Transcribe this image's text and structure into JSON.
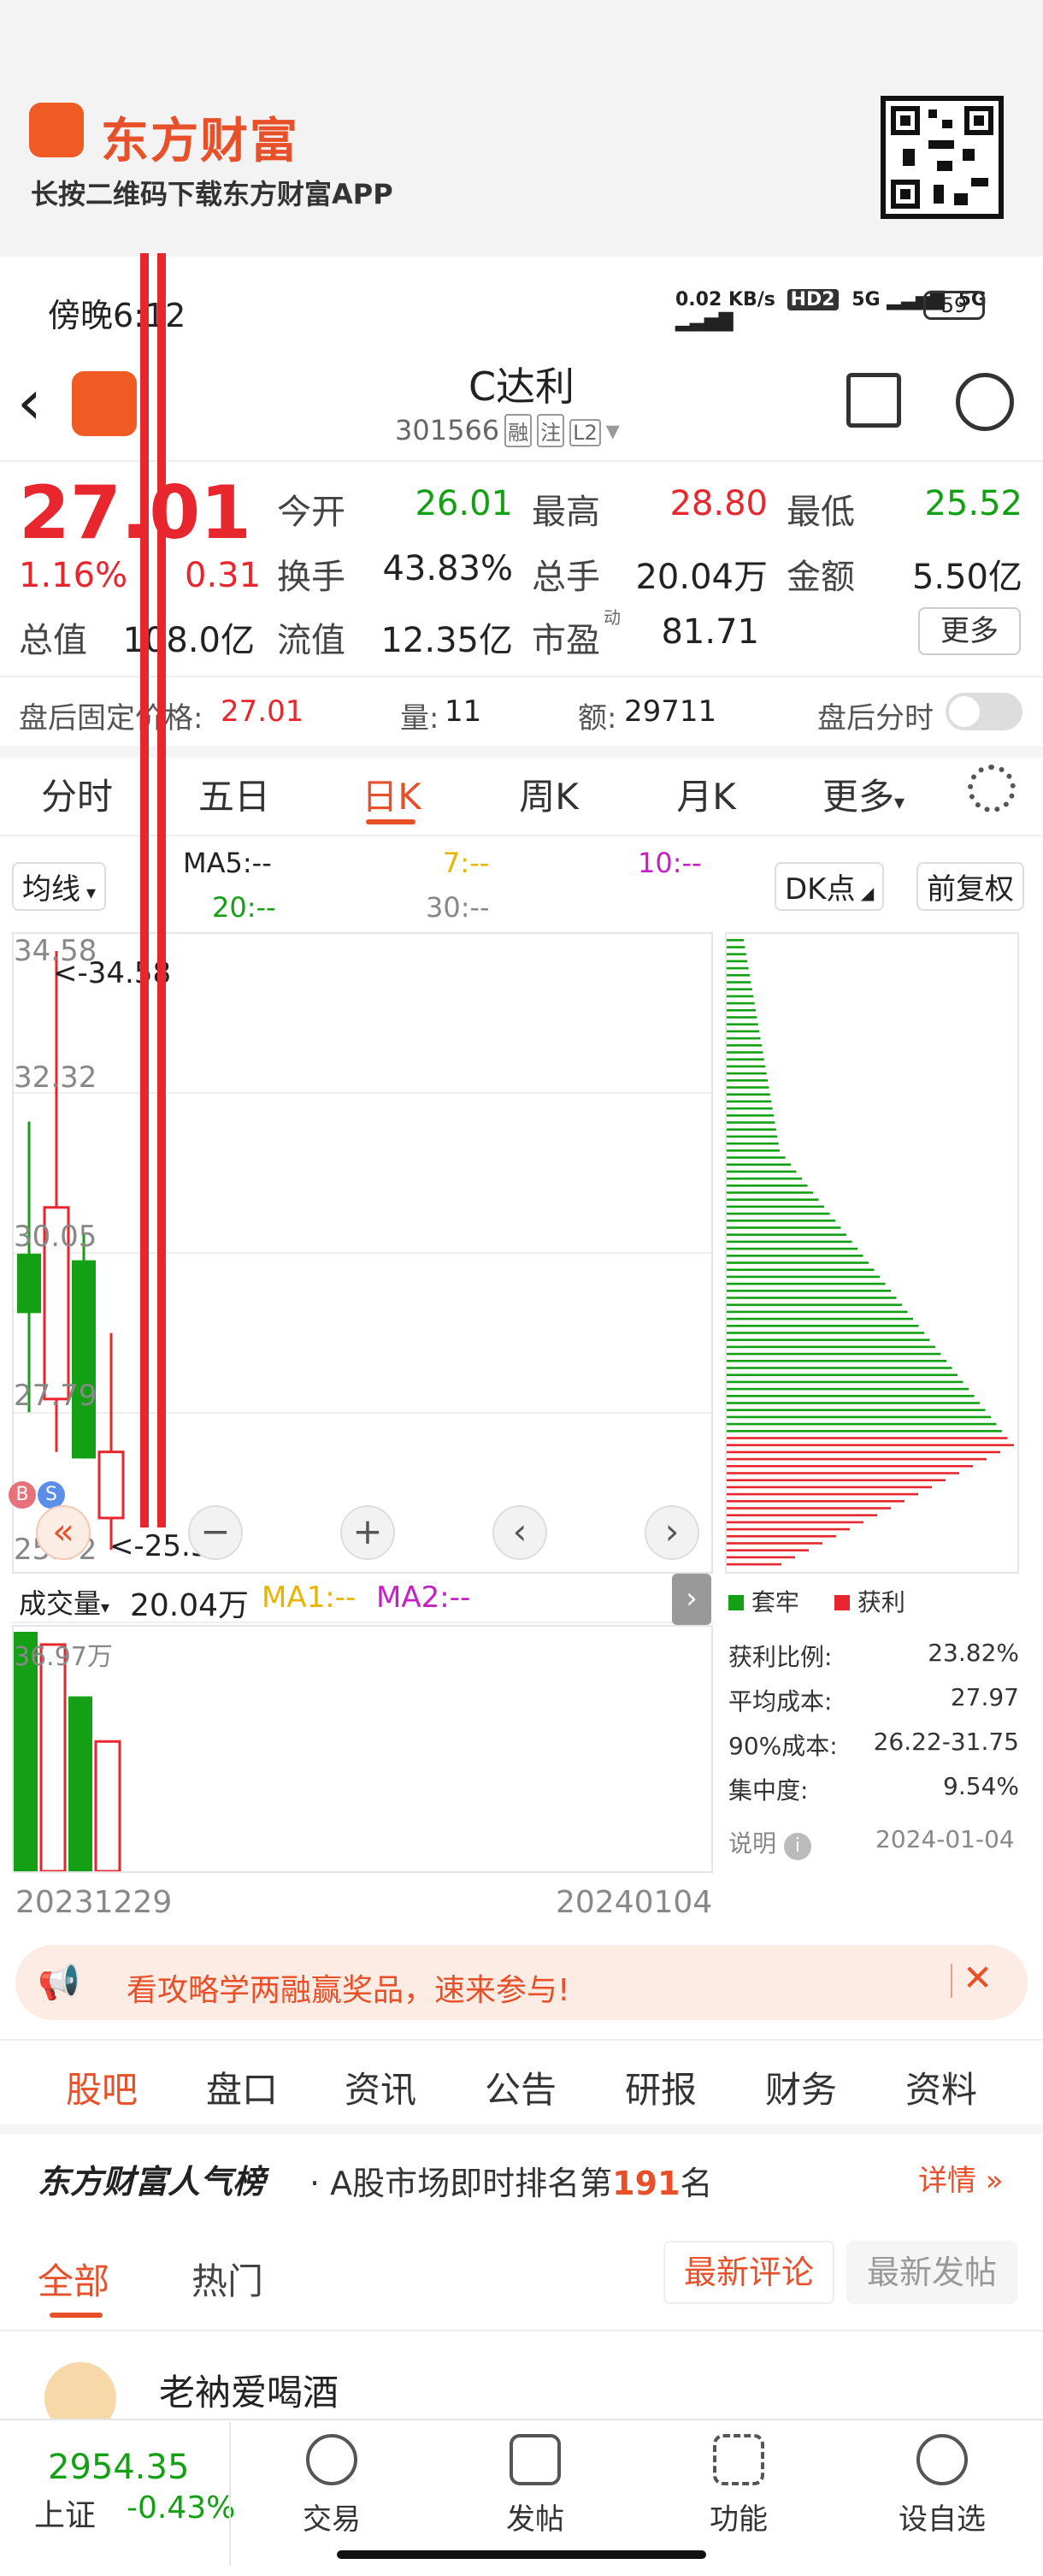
{
  "banner": {
    "brand": "东方财富",
    "tagline": "长按二维码下载东方财富APP"
  },
  "status": {
    "time": "傍晚6:12",
    "net_speed": "0.02 KB/s",
    "hd": "HD2",
    "sig1": "5G",
    "sig2": "5G",
    "battery": "59"
  },
  "header": {
    "name": "C达利",
    "code": "301566",
    "tags": [
      "融",
      "注",
      "L2"
    ]
  },
  "quote": {
    "price": "27.01",
    "change_pct": "1.16%",
    "change_amt": "0.31",
    "rows": [
      [
        {
          "label": "今开",
          "value": "26.01",
          "color": "#14a014"
        },
        {
          "label": "最高",
          "value": "28.80",
          "color": "#e8262e"
        },
        {
          "label": "最低",
          "value": "25.52",
          "color": "#14a014"
        }
      ],
      [
        {
          "label": "换手",
          "value": "43.83%",
          "color": "#222222"
        },
        {
          "label": "总手",
          "value": "20.04万",
          "color": "#222222"
        },
        {
          "label": "金额",
          "value": "5.50亿",
          "color": "#222222"
        }
      ],
      [
        {
          "label": "总值",
          "value": "108.0亿",
          "color": "#222222"
        },
        {
          "label": "流值",
          "value": "12.35亿",
          "color": "#222222"
        },
        {
          "label": "市盈",
          "value": "81.71",
          "color": "#222222"
        }
      ]
    ],
    "pe_sup": "动",
    "more": "更多"
  },
  "after_hours": {
    "price_label": "盘后固定价格:",
    "price": "27.01",
    "vol_label": "量:",
    "vol": "11",
    "amt_label": "额:",
    "amt": "29711",
    "timeshare_label": "盘后分时"
  },
  "period_tabs": [
    "分时",
    "五日",
    "日K",
    "周K",
    "月K",
    "更多"
  ],
  "active_tab": "日K",
  "ma": {
    "mode": "均线",
    "ma5": "MA5:--",
    "ma7": "7:--",
    "ma10": "10:--",
    "ma20": "20:--",
    "ma30": "30:--",
    "dk": "DK点",
    "adjust": "前复权"
  },
  "chart_data": {
    "type": "candlestick",
    "y_labels": [
      "34.58",
      "32.32",
      "30.05",
      "27.79",
      "25.52"
    ],
    "high_marker": "<-34.58",
    "low_marker": "<-25.52",
    "candles": [
      {
        "open": 30.0,
        "close": 29.1,
        "high": 32.0,
        "low": 27.6,
        "color": "green"
      },
      {
        "open": 27.8,
        "close": 30.7,
        "high": 34.58,
        "low": 27.0,
        "color": "red"
      },
      {
        "open": 29.9,
        "close": 26.9,
        "high": 30.3,
        "low": 26.9,
        "color": "green"
      },
      {
        "open": 26.0,
        "close": 27.0,
        "high": 28.8,
        "low": 25.52,
        "color": "red"
      }
    ],
    "volumes": [
      36.97,
      35.0,
      27.0,
      20.04
    ],
    "vol_max_label": "36.97万",
    "x_start": "20231229",
    "x_end": "20240104",
    "dist_profit_share": 0.1
  },
  "volume": {
    "label": "成交量",
    "value": "20.04万",
    "ma1": "MA1:--",
    "ma2": "MA2:--"
  },
  "distribution": {
    "legend_trap": "套牢",
    "legend_profit": "获利",
    "stats": [
      {
        "label": "获利比例:",
        "value": "23.82%"
      },
      {
        "label": "平均成本:",
        "value": "27.97"
      },
      {
        "label": "90%成本:",
        "value": "26.22-31.75"
      },
      {
        "label": "集中度:",
        "value": "9.54%"
      }
    ],
    "note": "说明",
    "date": "2024-01-04"
  },
  "promo": {
    "text": "看攻略学两融赢奖品，速来参与!"
  },
  "content_tabs": [
    "股吧",
    "盘口",
    "资讯",
    "公告",
    "研报",
    "财务",
    "资料"
  ],
  "ranking": {
    "title": "东方财富人气榜",
    "desc": "A股市场即时排名第",
    "rank": "191",
    "suffix": "名",
    "detail": "详情"
  },
  "feed": {
    "tab_all": "全部",
    "tab_hot": "热门",
    "sort_latest_comment": "最新评论",
    "sort_latest_post": "最新发帖",
    "first_user": "老衲爱喝酒"
  },
  "bottom": {
    "index_value": "2954.35",
    "index_name": "上证",
    "index_change": "-0.43%",
    "items": [
      "交易",
      "发帖",
      "功能",
      "设自选"
    ]
  }
}
